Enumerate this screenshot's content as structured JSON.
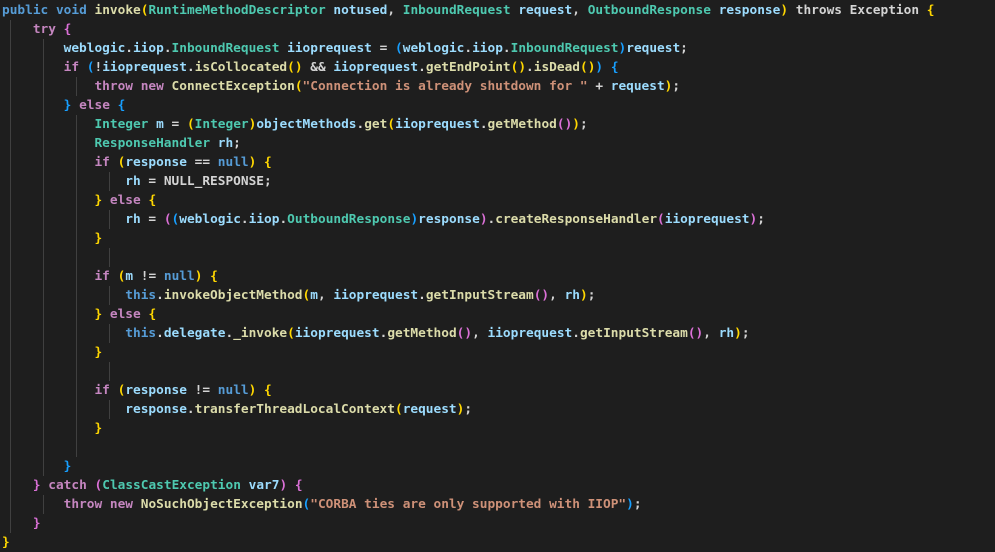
{
  "editor": {
    "language": "java",
    "background": "#1e1e1e",
    "palette": {
      "kw": "#569CD6",
      "ctrl": "#C586C0",
      "fn": "#DCDCAA",
      "type": "#4EC9B0",
      "var": "#9CDCFE",
      "txt": "#D4D4D4",
      "str": "#CE9178",
      "b1": "#FFD700",
      "b2": "#DA70D6",
      "b3": "#179FFF",
      "guide": "#404040"
    },
    "lines": [
      {
        "g": 0,
        "t": [
          [
            "public",
            "kw"
          ],
          [
            " ",
            "txt"
          ],
          [
            "void",
            "kw"
          ],
          [
            " ",
            "txt"
          ],
          [
            "invoke",
            "fn"
          ],
          [
            "(",
            "b1"
          ],
          [
            "RuntimeMethodDescriptor",
            "type"
          ],
          [
            " ",
            "txt"
          ],
          [
            "notused",
            "var"
          ],
          [
            ", ",
            "txt"
          ],
          [
            "InboundRequest",
            "type"
          ],
          [
            " ",
            "txt"
          ],
          [
            "request",
            "var"
          ],
          [
            ", ",
            "txt"
          ],
          [
            "OutboundResponse",
            "type"
          ],
          [
            " ",
            "txt"
          ],
          [
            "response",
            "var"
          ],
          [
            ")",
            "b1"
          ],
          [
            " throws Exception ",
            "txt"
          ],
          [
            "{",
            "b1"
          ]
        ]
      },
      {
        "g": 1,
        "t": [
          [
            "    ",
            "txt"
          ],
          [
            "try",
            "ctrl"
          ],
          [
            " ",
            "txt"
          ],
          [
            "{",
            "b2"
          ]
        ]
      },
      {
        "g": 2,
        "t": [
          [
            "        ",
            "txt"
          ],
          [
            "weblogic",
            "var"
          ],
          [
            ".",
            "txt"
          ],
          [
            "iiop",
            "var"
          ],
          [
            ".",
            "txt"
          ],
          [
            "InboundRequest",
            "type"
          ],
          [
            " ",
            "txt"
          ],
          [
            "iioprequest",
            "var"
          ],
          [
            " = ",
            "txt"
          ],
          [
            "(",
            "b3"
          ],
          [
            "weblogic",
            "var"
          ],
          [
            ".",
            "txt"
          ],
          [
            "iiop",
            "var"
          ],
          [
            ".",
            "txt"
          ],
          [
            "InboundRequest",
            "type"
          ],
          [
            ")",
            "b3"
          ],
          [
            "request",
            "var"
          ],
          [
            ";",
            "txt"
          ]
        ]
      },
      {
        "g": 2,
        "t": [
          [
            "        ",
            "txt"
          ],
          [
            "if",
            "ctrl"
          ],
          [
            " ",
            "txt"
          ],
          [
            "(",
            "b3"
          ],
          [
            "!",
            "txt"
          ],
          [
            "iioprequest",
            "var"
          ],
          [
            ".",
            "txt"
          ],
          [
            "isCollocated",
            "fn"
          ],
          [
            "()",
            "b1"
          ],
          [
            " && ",
            "txt"
          ],
          [
            "iioprequest",
            "var"
          ],
          [
            ".",
            "txt"
          ],
          [
            "getEndPoint",
            "fn"
          ],
          [
            "()",
            "b1"
          ],
          [
            ".",
            "txt"
          ],
          [
            "isDead",
            "fn"
          ],
          [
            "()",
            "b1"
          ],
          [
            ")",
            "b3"
          ],
          [
            " ",
            "txt"
          ],
          [
            "{",
            "b3"
          ]
        ]
      },
      {
        "g": 3,
        "t": [
          [
            "            ",
            "txt"
          ],
          [
            "throw",
            "ctrl"
          ],
          [
            " ",
            "txt"
          ],
          [
            "new",
            "ctrl"
          ],
          [
            " ",
            "txt"
          ],
          [
            "ConnectException",
            "fn"
          ],
          [
            "(",
            "b1"
          ],
          [
            "\"Connection is already shutdown for \"",
            "str"
          ],
          [
            " + ",
            "txt"
          ],
          [
            "request",
            "var"
          ],
          [
            ")",
            "b1"
          ],
          [
            ";",
            "txt"
          ]
        ]
      },
      {
        "g": 2,
        "t": [
          [
            "        ",
            "txt"
          ],
          [
            "}",
            "b3"
          ],
          [
            " ",
            "txt"
          ],
          [
            "else",
            "ctrl"
          ],
          [
            " ",
            "txt"
          ],
          [
            "{",
            "b3"
          ]
        ]
      },
      {
        "g": 3,
        "t": [
          [
            "            ",
            "txt"
          ],
          [
            "Integer",
            "type"
          ],
          [
            " ",
            "txt"
          ],
          [
            "m",
            "var"
          ],
          [
            " = ",
            "txt"
          ],
          [
            "(",
            "b1"
          ],
          [
            "Integer",
            "type"
          ],
          [
            ")",
            "b1"
          ],
          [
            "objectMethods",
            "var"
          ],
          [
            ".",
            "txt"
          ],
          [
            "get",
            "fn"
          ],
          [
            "(",
            "b1"
          ],
          [
            "iioprequest",
            "var"
          ],
          [
            ".",
            "txt"
          ],
          [
            "getMethod",
            "fn"
          ],
          [
            "()",
            "b2"
          ],
          [
            ")",
            "b1"
          ],
          [
            ";",
            "txt"
          ]
        ]
      },
      {
        "g": 3,
        "t": [
          [
            "            ",
            "txt"
          ],
          [
            "ResponseHandler",
            "type"
          ],
          [
            " ",
            "txt"
          ],
          [
            "rh",
            "var"
          ],
          [
            ";",
            "txt"
          ]
        ]
      },
      {
        "g": 3,
        "t": [
          [
            "            ",
            "txt"
          ],
          [
            "if",
            "ctrl"
          ],
          [
            " ",
            "txt"
          ],
          [
            "(",
            "b1"
          ],
          [
            "response",
            "var"
          ],
          [
            " == ",
            "txt"
          ],
          [
            "null",
            "kw"
          ],
          [
            ")",
            "b1"
          ],
          [
            " ",
            "txt"
          ],
          [
            "{",
            "b1"
          ]
        ]
      },
      {
        "g": 4,
        "t": [
          [
            "                ",
            "txt"
          ],
          [
            "rh",
            "var"
          ],
          [
            " = NULL_RESPONSE;",
            "txt"
          ]
        ]
      },
      {
        "g": 3,
        "t": [
          [
            "            ",
            "txt"
          ],
          [
            "}",
            "b1"
          ],
          [
            " ",
            "txt"
          ],
          [
            "else",
            "ctrl"
          ],
          [
            " ",
            "txt"
          ],
          [
            "{",
            "b1"
          ]
        ]
      },
      {
        "g": 4,
        "t": [
          [
            "                ",
            "txt"
          ],
          [
            "rh",
            "var"
          ],
          [
            " = ",
            "txt"
          ],
          [
            "(",
            "b2"
          ],
          [
            "(",
            "b3"
          ],
          [
            "weblogic",
            "var"
          ],
          [
            ".",
            "txt"
          ],
          [
            "iiop",
            "var"
          ],
          [
            ".",
            "txt"
          ],
          [
            "OutboundResponse",
            "type"
          ],
          [
            ")",
            "b3"
          ],
          [
            "response",
            "var"
          ],
          [
            ")",
            "b2"
          ],
          [
            ".",
            "txt"
          ],
          [
            "createResponseHandler",
            "fn"
          ],
          [
            "(",
            "b2"
          ],
          [
            "iioprequest",
            "var"
          ],
          [
            ")",
            "b2"
          ],
          [
            ";",
            "txt"
          ]
        ]
      },
      {
        "g": 3,
        "t": [
          [
            "            ",
            "txt"
          ],
          [
            "}",
            "b1"
          ]
        ]
      },
      {
        "g": 4,
        "t": []
      },
      {
        "g": 3,
        "t": [
          [
            "            ",
            "txt"
          ],
          [
            "if",
            "ctrl"
          ],
          [
            " ",
            "txt"
          ],
          [
            "(",
            "b1"
          ],
          [
            "m",
            "var"
          ],
          [
            " != ",
            "txt"
          ],
          [
            "null",
            "kw"
          ],
          [
            ")",
            "b1"
          ],
          [
            " ",
            "txt"
          ],
          [
            "{",
            "b1"
          ]
        ]
      },
      {
        "g": 4,
        "t": [
          [
            "                ",
            "txt"
          ],
          [
            "this",
            "kw"
          ],
          [
            ".",
            "txt"
          ],
          [
            "invokeObjectMethod",
            "fn"
          ],
          [
            "(",
            "b1"
          ],
          [
            "m",
            "var"
          ],
          [
            ", ",
            "txt"
          ],
          [
            "iioprequest",
            "var"
          ],
          [
            ".",
            "txt"
          ],
          [
            "getInputStream",
            "fn"
          ],
          [
            "()",
            "b2"
          ],
          [
            ", ",
            "txt"
          ],
          [
            "rh",
            "var"
          ],
          [
            ")",
            "b1"
          ],
          [
            ";",
            "txt"
          ]
        ]
      },
      {
        "g": 3,
        "t": [
          [
            "            ",
            "txt"
          ],
          [
            "}",
            "b1"
          ],
          [
            " ",
            "txt"
          ],
          [
            "else",
            "ctrl"
          ],
          [
            " ",
            "txt"
          ],
          [
            "{",
            "b1"
          ]
        ]
      },
      {
        "g": 4,
        "t": [
          [
            "                ",
            "txt"
          ],
          [
            "this",
            "kw"
          ],
          [
            ".",
            "txt"
          ],
          [
            "delegate",
            "var"
          ],
          [
            ".",
            "txt"
          ],
          [
            "_invoke",
            "fn"
          ],
          [
            "(",
            "b1"
          ],
          [
            "iioprequest",
            "var"
          ],
          [
            ".",
            "txt"
          ],
          [
            "getMethod",
            "fn"
          ],
          [
            "()",
            "b2"
          ],
          [
            ", ",
            "txt"
          ],
          [
            "iioprequest",
            "var"
          ],
          [
            ".",
            "txt"
          ],
          [
            "getInputStream",
            "fn"
          ],
          [
            "()",
            "b2"
          ],
          [
            ", ",
            "txt"
          ],
          [
            "rh",
            "var"
          ],
          [
            ")",
            "b1"
          ],
          [
            ";",
            "txt"
          ]
        ]
      },
      {
        "g": 3,
        "t": [
          [
            "            ",
            "txt"
          ],
          [
            "}",
            "b1"
          ]
        ]
      },
      {
        "g": 4,
        "t": []
      },
      {
        "g": 3,
        "t": [
          [
            "            ",
            "txt"
          ],
          [
            "if",
            "ctrl"
          ],
          [
            " ",
            "txt"
          ],
          [
            "(",
            "b1"
          ],
          [
            "response",
            "var"
          ],
          [
            " != ",
            "txt"
          ],
          [
            "null",
            "kw"
          ],
          [
            ")",
            "b1"
          ],
          [
            " ",
            "txt"
          ],
          [
            "{",
            "b1"
          ]
        ]
      },
      {
        "g": 4,
        "t": [
          [
            "                ",
            "txt"
          ],
          [
            "response",
            "var"
          ],
          [
            ".",
            "txt"
          ],
          [
            "transferThreadLocalContext",
            "fn"
          ],
          [
            "(",
            "b1"
          ],
          [
            "request",
            "var"
          ],
          [
            ")",
            "b1"
          ],
          [
            ";",
            "txt"
          ]
        ]
      },
      {
        "g": 3,
        "t": [
          [
            "            ",
            "txt"
          ],
          [
            "}",
            "b1"
          ]
        ]
      },
      {
        "g": 3,
        "t": []
      },
      {
        "g": 2,
        "t": [
          [
            "        ",
            "txt"
          ],
          [
            "}",
            "b3"
          ]
        ]
      },
      {
        "g": 1,
        "t": [
          [
            "    ",
            "txt"
          ],
          [
            "}",
            "b2"
          ],
          [
            " ",
            "txt"
          ],
          [
            "catch",
            "ctrl"
          ],
          [
            " ",
            "txt"
          ],
          [
            "(",
            "b2"
          ],
          [
            "ClassCastException",
            "type"
          ],
          [
            " ",
            "txt"
          ],
          [
            "var7",
            "var"
          ],
          [
            ")",
            "b2"
          ],
          [
            " ",
            "txt"
          ],
          [
            "{",
            "b2"
          ]
        ]
      },
      {
        "g": 2,
        "t": [
          [
            "        ",
            "txt"
          ],
          [
            "throw",
            "ctrl"
          ],
          [
            " ",
            "txt"
          ],
          [
            "new",
            "ctrl"
          ],
          [
            " ",
            "txt"
          ],
          [
            "NoSuchObjectException",
            "fn"
          ],
          [
            "(",
            "b3"
          ],
          [
            "\"CORBA ties are only supported with IIOP\"",
            "str"
          ],
          [
            ")",
            "b3"
          ],
          [
            ";",
            "txt"
          ]
        ]
      },
      {
        "g": 1,
        "t": [
          [
            "    ",
            "txt"
          ],
          [
            "}",
            "b2"
          ]
        ]
      },
      {
        "g": 0,
        "t": [
          [
            "}",
            "b1"
          ]
        ]
      }
    ]
  }
}
